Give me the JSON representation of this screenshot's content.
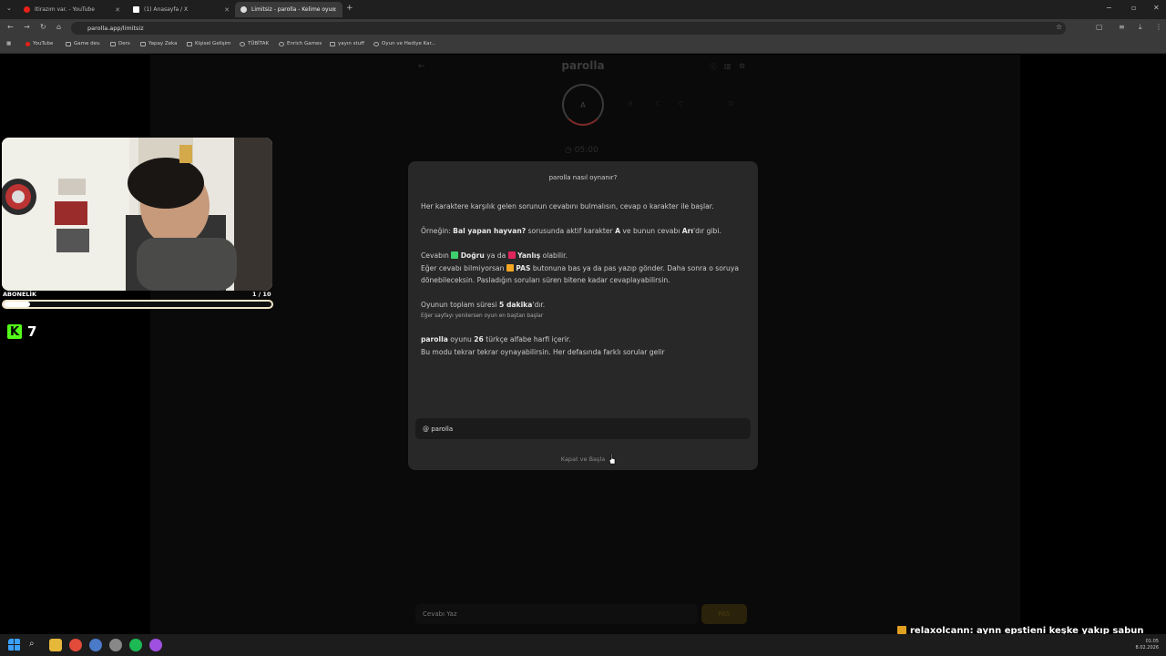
{
  "browser": {
    "tabs": [
      {
        "label": "Itirazım var. - YouTube",
        "favicon_color": "#e62117",
        "active": false
      },
      {
        "label": "(1) Anasayfa / X",
        "favicon_color": "#ffffff",
        "active": false
      },
      {
        "label": "Limitsiz - parolla - Kelime oyun",
        "favicon_color": "#dddddd",
        "active": true
      }
    ],
    "new_tab": "+",
    "url": "parolla.app/limitsiz",
    "bookmarks": [
      "YouTube",
      "Game dev.",
      "Ders",
      "Yapay Zeka",
      "Kişisel Gelişim",
      "TÜBİTAK",
      "Enrich Games",
      "yayın stuff",
      "Oyun ve Hediye Kar..."
    ]
  },
  "app": {
    "title": "parolla",
    "current_letter": "A",
    "letters": [
      "B",
      "C",
      "Ç",
      "D"
    ],
    "timer": "05:00",
    "answer_placeholder": "Cevabı Yaz",
    "pass_label": "PAS"
  },
  "modal": {
    "title": "parolla nasıl oynanır?",
    "p1": "Her karaktere karşılık gelen sorunun cevabını bulmalısın, cevap o karakter ile başlar.",
    "ex_prefix": "Örneğin: ",
    "ex_question": "Bal yapan hayvan?",
    "ex_mid1": " sorusunda aktif karakter ",
    "ex_letter": "A",
    "ex_mid2": " ve bunun cevabı ",
    "ex_answer": "Arı",
    "ex_suffix": "'dır gibi.",
    "ans_prefix": "Cevabın ",
    "correct": "Doğru",
    "ans_mid": " ya da ",
    "wrong": "Yanlış",
    "ans_suffix": " olabilir.",
    "pass_prefix": "Eğer cevabı bilmiyorsan ",
    "pass": "PAS",
    "pass_suffix": " butonuna bas ya da pas yazıp gönder. Daha sonra o soruya dönebileceksin. Pasladığın soruları süren bitene kadar cevaplayabilirsin.",
    "time_prefix": "Oyunun toplam süresi ",
    "time_value": "5 dakika",
    "time_suffix": "'dır.",
    "refresh_note": "Eğer sayfayı yenilersen oyun en baştan başlar",
    "letters_brand": "parolla",
    "letters_mid": " oyunu ",
    "letters_count": "26",
    "letters_suffix": " türkçe alfabe harfi içerir.",
    "replay": "Bu modu tekrar tekrar oynayabilirsin. Her defasında farklı sorular gelir",
    "credit": "@ parolla",
    "start_button": "Kapat ve Başla",
    "colors": {
      "correct": "#3ecf6e",
      "wrong": "#e0245e",
      "pass": "#f5a623"
    }
  },
  "stream": {
    "sub_label": "ABONELİK",
    "sub_count": "1 / 10",
    "sub_progress": 0.1,
    "kick_viewers": "7",
    "chat_user": "relaxolcann",
    "chat_message": ": aynn epstieni keşke yakıp sabun yapsaydı htler"
  },
  "taskbar": {
    "time": "01:05",
    "date": "8.02.2026"
  }
}
